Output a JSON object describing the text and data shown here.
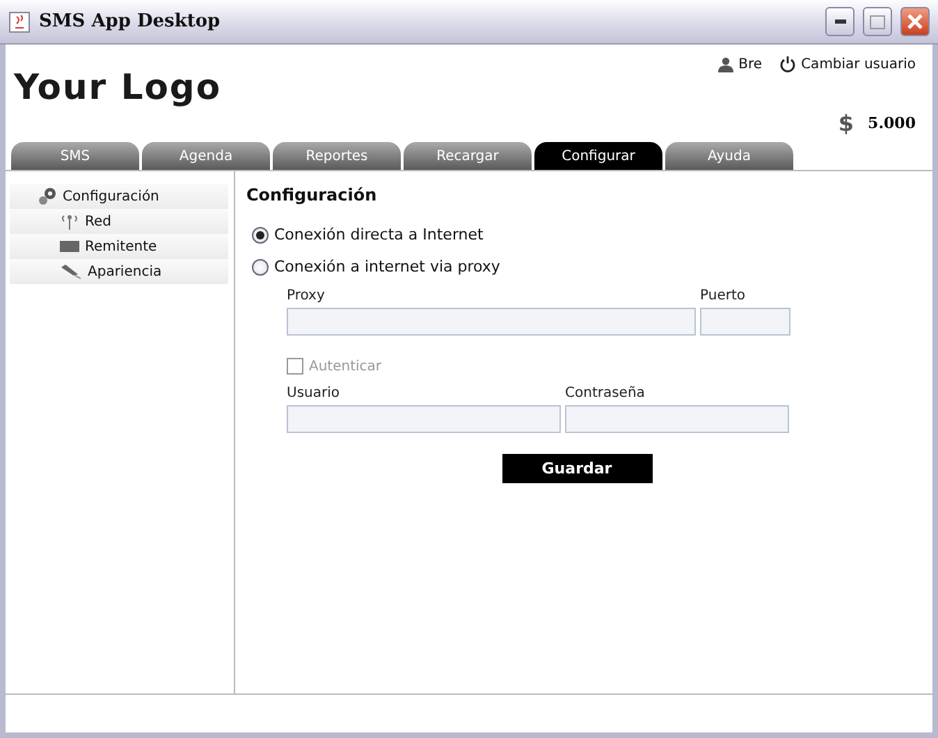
{
  "window": {
    "title": "SMS App Desktop"
  },
  "header": {
    "logo": "Your Logo",
    "user": "Bre",
    "switch_user": "Cambiar usuario",
    "balance_symbol": "$",
    "balance": "5.000"
  },
  "tabs": [
    {
      "label": "SMS",
      "selected": false
    },
    {
      "label": "Agenda",
      "selected": false
    },
    {
      "label": "Reportes",
      "selected": false
    },
    {
      "label": "Recargar",
      "selected": false
    },
    {
      "label": "Configurar",
      "selected": true
    },
    {
      "label": "Ayuda",
      "selected": false
    }
  ],
  "sidebar": {
    "items": [
      {
        "label": "Configuración",
        "kind": "gears",
        "children": [
          {
            "label": "Red",
            "kind": "antenna"
          },
          {
            "label": "Remitente",
            "kind": "envelope"
          },
          {
            "label": "Apariencia",
            "kind": "brush"
          }
        ]
      }
    ]
  },
  "form": {
    "title": "Configuración",
    "options": [
      {
        "label": "Conexión directa a Internet",
        "selected": true
      },
      {
        "label": "Conexión a internet via proxy",
        "selected": false
      }
    ],
    "proxy_label": "Proxy",
    "port_label": "Puerto",
    "proxy_disabled": true,
    "authenticate": {
      "label": "Autenticar",
      "checked": false,
      "disabled": true
    },
    "user_label": "Usuario",
    "password_label": "Contraseña",
    "save": "Guardar"
  }
}
